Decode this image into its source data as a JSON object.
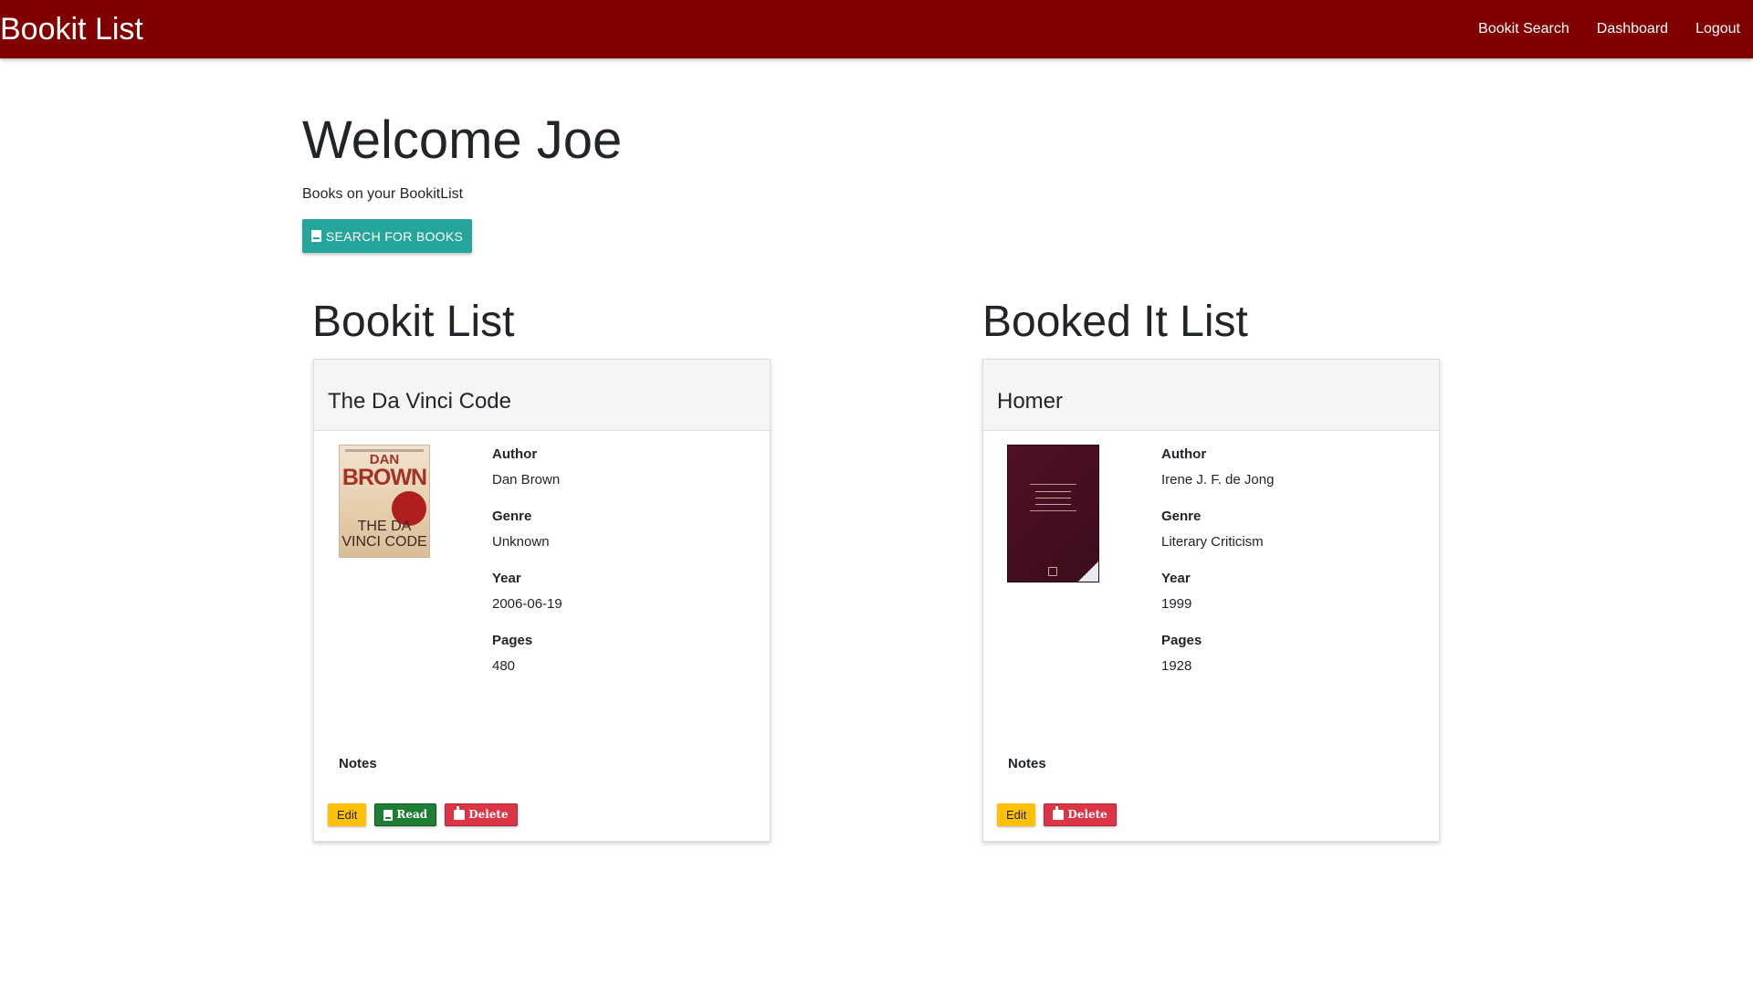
{
  "navbar": {
    "brand": "Bookit List",
    "links": [
      "Bookit Search",
      "Dashboard",
      "Logout"
    ],
    "bg_color": "#800000"
  },
  "header": {
    "welcome": "Welcome Joe",
    "subtitle": "Books on your BookitList",
    "search_button": {
      "label": "SEARCH FOR BOOKS",
      "icon": "book-icon",
      "color": "#26a69a"
    }
  },
  "bookit_list": {
    "title": "Bookit List",
    "book": {
      "title": "The Da Vinci Code",
      "cover": {
        "author_line1": "DAN",
        "author_line2": "BROWN",
        "title_text": "THE DA VINCI CODE"
      },
      "labels": {
        "author": "Author",
        "genre": "Genre",
        "year": "Year",
        "pages": "Pages",
        "notes": "Notes"
      },
      "author": "Dan Brown",
      "genre": "Unknown",
      "year": "2006-06-19",
      "pages": "480",
      "buttons": {
        "edit": "Edit",
        "read": "Read",
        "delete": "Delete"
      }
    }
  },
  "booked_it_list": {
    "title": "Booked It List",
    "book": {
      "title": "Homer",
      "labels": {
        "author": "Author",
        "genre": "Genre",
        "year": "Year",
        "pages": "Pages",
        "notes": "Notes"
      },
      "author": "Irene J. F. de Jong",
      "genre": "Literary Criticism",
      "year": "1999",
      "pages": "1928",
      "buttons": {
        "edit": "Edit",
        "delete": "Delete"
      }
    }
  },
  "colors": {
    "edit": "#ffc107",
    "read": "#1e7e34",
    "delete": "#dc3545"
  }
}
